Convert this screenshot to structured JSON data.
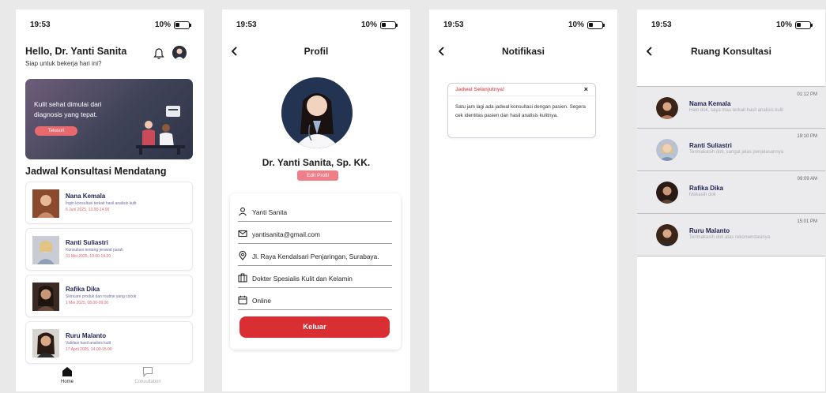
{
  "status": {
    "time": "19:53",
    "battery": "10%"
  },
  "home": {
    "greeting": "Hello, Dr. Yanti Sanita",
    "subtitle": "Siap untuk bekerja hari ini?",
    "banner": {
      "text": "Kulit sehat dimulai dari diagnosis yang tepat.",
      "button": "Telusuri"
    },
    "section_title": "Jadwal Konsultasi Mendatang",
    "appointments": [
      {
        "name": "Nana Kemala",
        "desc": "Ingin konsultasi terkait hasil analisis kulit",
        "date": "6 Juni 2025, 13.00-14.00"
      },
      {
        "name": "Ranti Suliastri",
        "desc": "Konsultasi tentang jerawat parah",
        "date": "31 Mei 2025, 19.00-19.20"
      },
      {
        "name": "Rafika Dika",
        "desc": "Skincare produk dan routine yang cocok",
        "date": "1 Mei 2025, 08.00-09.00"
      },
      {
        "name": "Ruru Malanto",
        "desc": "Validasi hasil analisis kulit",
        "date": "17 April 2025, 14.00-15.00"
      }
    ],
    "nav": [
      {
        "label": "Home"
      },
      {
        "label": "Consultation"
      }
    ]
  },
  "profile": {
    "title": "Profil",
    "name": "Dr. Yanti Sanita, Sp. KK.",
    "edit_button": "Edit Profil",
    "fields": {
      "full_name": "Yanti Sanita",
      "email": "yantisanita@gmail.com",
      "address": "Jl. Raya Kendalsari Penjaringan, Surabaya.",
      "specialty": "Dokter Spesialis Kulit dan Kelamin",
      "status": "Online"
    },
    "logout_button": "Keluar"
  },
  "notifications": {
    "title": "Notifikasi",
    "card": {
      "title": "Jadwal Selanjutnya!",
      "close": "×",
      "body": "Satu jam lagi ada jadwal konsultasi dengan pasien. Segera cek identitas pasien dan hasil analisis kulitnya."
    }
  },
  "consultation": {
    "title": "Ruang Konsultasi",
    "chats": [
      {
        "name": "Nama Kemala",
        "message": "Halo dok, saya mau terkait hasil analisis kulit",
        "time": "01:12 PM"
      },
      {
        "name": "Ranti Suliastri",
        "message": "Terimakasih dok, sangat jelas penjelasannya",
        "time": "19:10 PM"
      },
      {
        "name": "Rafika Dika",
        "message": "Makasih dok",
        "time": "09:09 AM"
      },
      {
        "name": "Ruru Malanto",
        "message": "Terimakasih dok atas rekomendasinya",
        "time": "15:01 PM"
      }
    ]
  },
  "colors": {
    "accent": "#ef7f86",
    "danger": "#d92f33",
    "navy": "#1d2150",
    "muted": "#a9a9b6"
  }
}
